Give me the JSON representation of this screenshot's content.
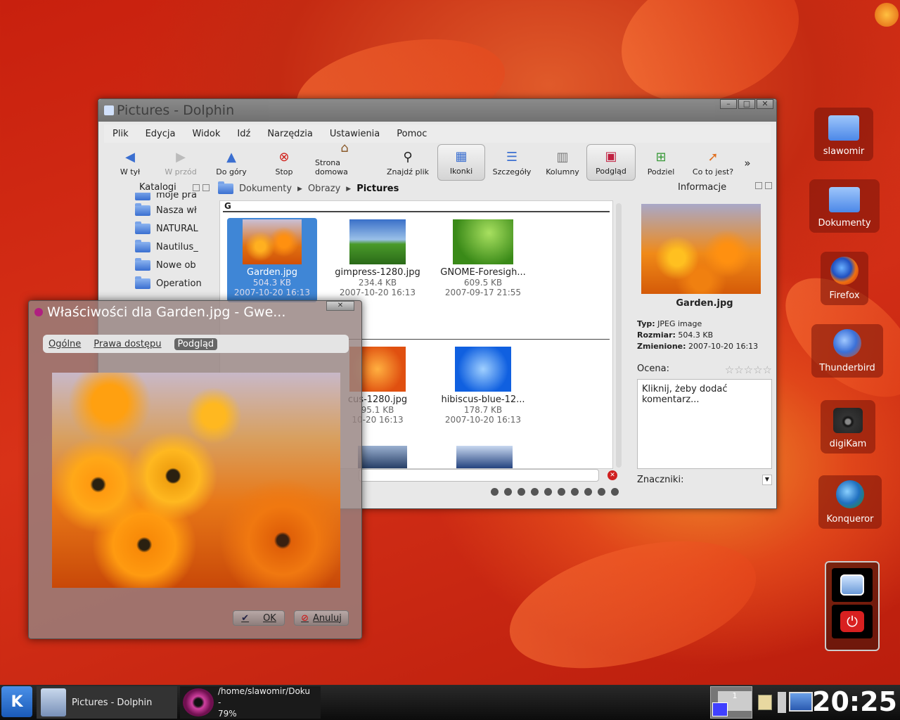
{
  "dolphin": {
    "title": "Pictures - Dolphin",
    "menu": [
      "Plik",
      "Edycja",
      "Widok",
      "Idź",
      "Narzędzia",
      "Ustawienia",
      "Pomoc"
    ],
    "toolbar": [
      "W tył",
      "W przód",
      "Do góry",
      "Stop",
      "Strona domowa",
      "Znajdź plik",
      "Ikonki",
      "Szczegóły",
      "Kolumny",
      "Podgląd",
      "Podziel",
      "Co to jest?"
    ],
    "overflow": "»",
    "sidebar": {
      "title": "Katalogi",
      "items": [
        "moje pra",
        "Nasza wł",
        "NATURAL",
        "Nautilus_",
        "Nowe ob",
        "Operation"
      ]
    },
    "breadcrumb": [
      "Dokumenty",
      "Obrazy",
      "Pictures"
    ],
    "group": "G",
    "files": [
      {
        "name": "Garden.jpg",
        "size": "504.3 KB",
        "date": "2007-10-20 16:13"
      },
      {
        "name": "gimpress-1280.jpg",
        "size": "234.4 KB",
        "date": "2007-10-20 16:13"
      },
      {
        "name": "GNOME-Foresigh...",
        "size": "609.5 KB",
        "date": "2007-09-17 21:55"
      },
      {
        "name": "cus-1280.jpg",
        "size": "95.1 KB",
        "date": "10-20 16:13"
      },
      {
        "name": "hibiscus-blue-12...",
        "size": "178.7 KB",
        "date": "2007-10-20 16:13"
      }
    ],
    "info": {
      "title": "Informacje",
      "filename": "Garden.jpg",
      "type_label": "Typ:",
      "type": "JPEG image",
      "size_label": "Rozmiar:",
      "size": "504.3 KB",
      "mod_label": "Zmienione:",
      "mod": "2007-10-20 16:13",
      "rating_label": "Ocena:",
      "rating": 0,
      "comment": "Kliknij, żeby dodać komentarz...",
      "tags_label": "Znaczniki:"
    }
  },
  "props": {
    "title": "Właściwości dla Garden.jpg - Gwe...",
    "tabs": [
      "Ogólne",
      "Prawa dostępu",
      "Podgląd"
    ],
    "ok": "OK",
    "cancel": "Anuluj"
  },
  "desktop": [
    "slawomir",
    "Dokumenty",
    "Firefox",
    "Thunderbird",
    "digiKam",
    "Konqueror"
  ],
  "taskbar": {
    "task1": "Pictures - Dolphin",
    "task2_line1": "/home/slawomir/Doku",
    "task2_line2": "-",
    "task2_line3": "79%",
    "pager": "1",
    "clock": "20:25"
  }
}
